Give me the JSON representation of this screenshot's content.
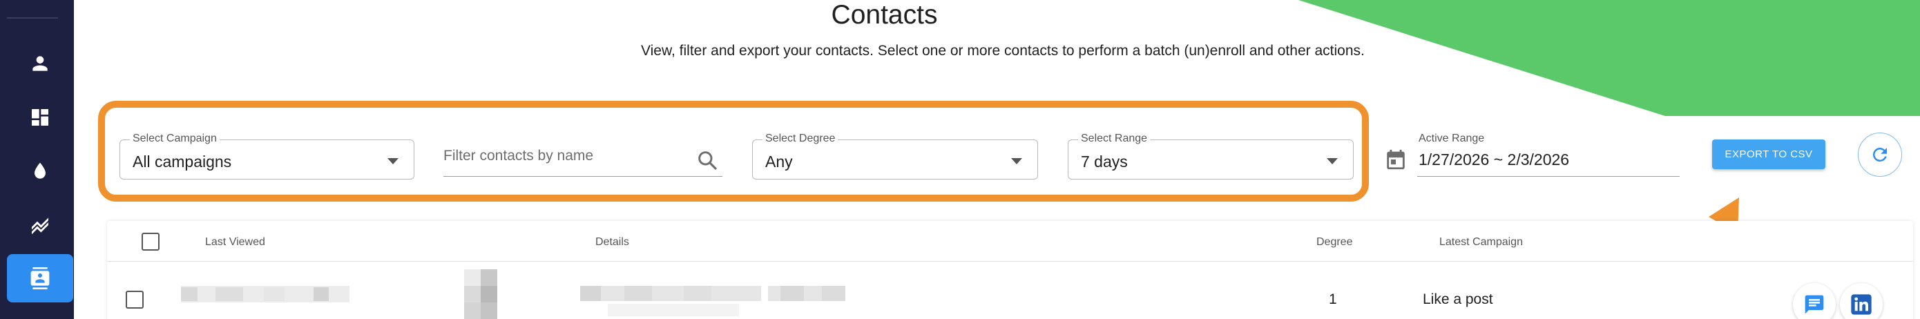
{
  "header": {
    "title": "Contacts",
    "subtitle": "View, filter and export your contacts. Select one or more contacts to perform a batch (un)enroll and other actions."
  },
  "sidebar": {
    "items": [
      {
        "icon": "person-icon",
        "active": false
      },
      {
        "icon": "dashboard-icon",
        "active": false
      },
      {
        "icon": "drop-icon",
        "active": false
      },
      {
        "icon": "chart-icon",
        "active": false
      },
      {
        "icon": "contacts-icon",
        "active": true
      }
    ]
  },
  "filters": {
    "campaign": {
      "label": "Select Campaign",
      "value": "All campaigns"
    },
    "search": {
      "placeholder": "Filter contacts by name",
      "value": ""
    },
    "degree": {
      "label": "Select Degree",
      "value": "Any"
    },
    "range": {
      "label": "Select Range",
      "value": "7 days"
    },
    "active_range": {
      "label": "Active Range",
      "value": "1/27/2026 ~ 2/3/2026"
    }
  },
  "actions": {
    "export_label": "EXPORT TO CSV"
  },
  "table": {
    "columns": [
      "Last Viewed",
      "Details",
      "Degree",
      "Latest Campaign"
    ],
    "rows": [
      {
        "last_viewed": "",
        "details": "",
        "degree": "1",
        "latest_campaign": "Like a post"
      }
    ]
  },
  "colors": {
    "sidebar": "#1e2041",
    "accent": "#2d8df0",
    "highlight": "#ef922e",
    "banner": "#5bc96a",
    "export": "#41a5f2"
  }
}
